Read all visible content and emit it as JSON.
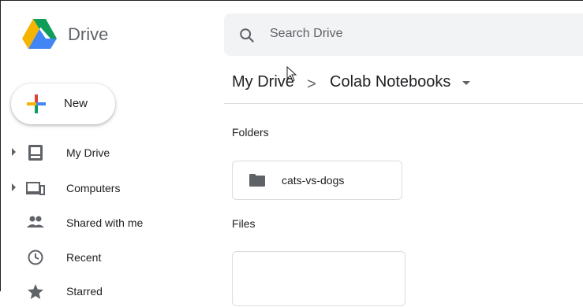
{
  "app": {
    "brand": "Drive",
    "colors": {
      "blue": "#4285f4",
      "green": "#0f9d58",
      "yellow": "#f4b400",
      "red": "#db4437"
    }
  },
  "search": {
    "placeholder": "Search Drive"
  },
  "new_button": {
    "label": "New"
  },
  "sidebar": {
    "items": [
      {
        "label": "My Drive",
        "icon": "my-drive-icon",
        "expandable": true
      },
      {
        "label": "Computers",
        "icon": "computers-icon",
        "expandable": true
      },
      {
        "label": "Shared with me",
        "icon": "shared-icon",
        "expandable": false
      },
      {
        "label": "Recent",
        "icon": "clock-icon",
        "expandable": false
      },
      {
        "label": "Starred",
        "icon": "star-icon",
        "expandable": false
      }
    ]
  },
  "breadcrumb": {
    "root": "My Drive",
    "separator": ">",
    "current": "Colab Notebooks"
  },
  "main": {
    "folders_heading": "Folders",
    "folders": [
      {
        "name": "cats-vs-dogs"
      }
    ],
    "files_heading": "Files"
  }
}
